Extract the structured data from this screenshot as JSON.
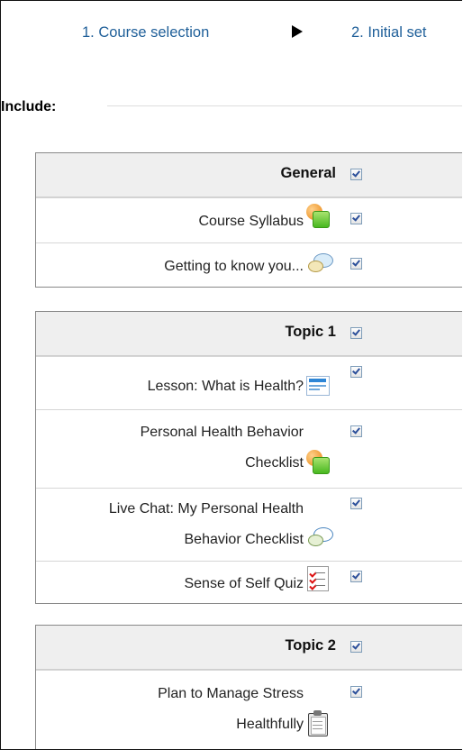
{
  "steps": {
    "step1": "1. Course selection",
    "step2": "2. Initial set"
  },
  "include_label": "Include:",
  "sections": [
    {
      "title": "General",
      "items": [
        {
          "label": "Course Syllabus",
          "icon": "assignment-icon"
        },
        {
          "label": "Getting to know you...",
          "icon": "forum-icon"
        }
      ]
    },
    {
      "title": "Topic 1",
      "items": [
        {
          "label": "Lesson: What is Health?",
          "icon": "lesson-icon"
        },
        {
          "label1": "Personal Health Behavior",
          "label2": "Checklist",
          "icon": "assignment-icon"
        },
        {
          "label1": "Live Chat: My Personal Health",
          "label2": "Behavior Checklist",
          "icon": "chat-icon"
        },
        {
          "label": "Sense of Self Quiz",
          "icon": "quiz-icon"
        }
      ]
    },
    {
      "title": "Topic 2",
      "items": [
        {
          "label1": "Plan to Manage Stress",
          "label2": "Healthfully",
          "icon": "clipboard-icon"
        }
      ]
    }
  ],
  "colors": {
    "link": "#1f5f99",
    "section_header_bg": "#efefef"
  }
}
